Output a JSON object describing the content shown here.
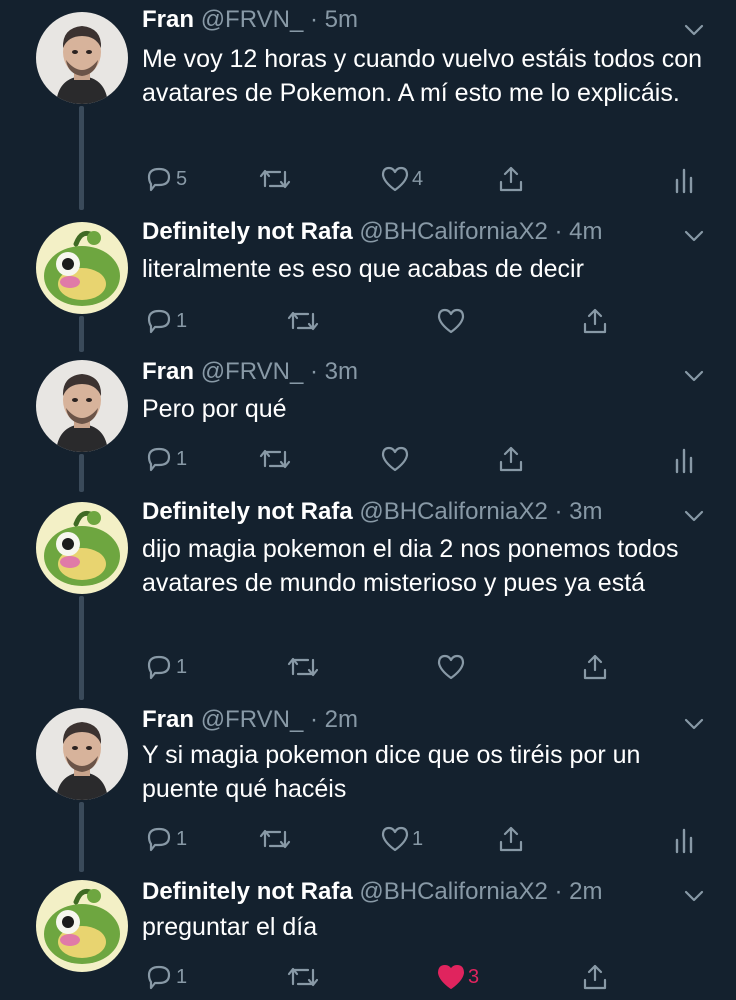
{
  "colors": {
    "background": "#14212e",
    "name": "#ffffff",
    "meta": "#8899a6",
    "like_active": "#e0245e",
    "connector": "#3a4a5a"
  },
  "tweets": [
    {
      "name": "Fran",
      "handle": "@FRVN_",
      "separator": "·",
      "time": "5m",
      "text": "Me voy 12 horas y cuando vuelvo estáis todos con avatares de Pokemon. A mí esto me lo explicáis.",
      "reply_count": "5",
      "retweet_count": "",
      "like_count": "4",
      "avatar_icon": "person-avatar",
      "has_analytics": true
    },
    {
      "name": "Definitely not Rafa",
      "handle": "@BHCaliforniaX2",
      "separator": "·",
      "time": "4m",
      "text": "literalmente es eso que acabas de decir",
      "reply_count": "1",
      "retweet_count": "",
      "like_count": "",
      "avatar_icon": "pokemon-avatar",
      "has_analytics": false
    },
    {
      "name": "Fran",
      "handle": "@FRVN_",
      "separator": "·",
      "time": "3m",
      "text": "Pero por qué",
      "reply_count": "1",
      "retweet_count": "",
      "like_count": "",
      "avatar_icon": "person-avatar",
      "has_analytics": true
    },
    {
      "name": "Definitely not Rafa",
      "handle": "@BHCaliforniaX2",
      "separator": "·",
      "time": "3m",
      "text": "dijo magia pokemon el dia 2 nos ponemos todos avatares de mundo misterioso y pues ya está",
      "reply_count": "1",
      "retweet_count": "",
      "like_count": "",
      "avatar_icon": "pokemon-avatar",
      "has_analytics": false
    },
    {
      "name": "Fran",
      "handle": "@FRVN_",
      "separator": "·",
      "time": "2m",
      "text": "Y si magia pokemon dice que os tiréis por un puente qué hacéis",
      "reply_count": "1",
      "retweet_count": "",
      "like_count": "1",
      "avatar_icon": "person-avatar",
      "has_analytics": true
    },
    {
      "name": "Definitely not Rafa",
      "handle": "@BHCaliforniaX2",
      "separator": "·",
      "time": "2m",
      "text": "preguntar el día",
      "reply_count": "1",
      "retweet_count": "",
      "like_count": "3",
      "liked": true,
      "avatar_icon": "pokemon-avatar",
      "has_analytics": false
    }
  ]
}
